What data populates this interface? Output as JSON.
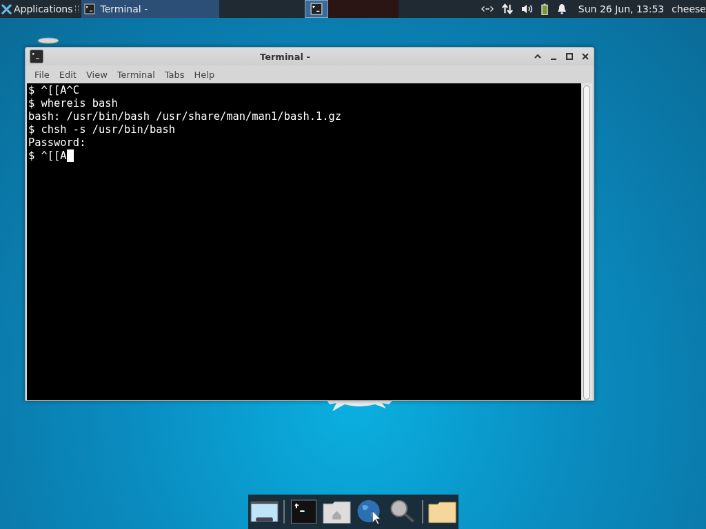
{
  "panel": {
    "app_menu": "Applications",
    "tasks": [
      {
        "title": "Terminal -",
        "selected": true
      }
    ],
    "workspaces": [
      {
        "selected": true
      },
      {
        "selected": false
      },
      {
        "selected": false
      },
      {
        "selected": false
      }
    ],
    "clock": "Sun 26 Jun, 13:53",
    "user": "cheese"
  },
  "window": {
    "title": "Terminal -",
    "menu": [
      "File",
      "Edit",
      "View",
      "Terminal",
      "Tabs",
      "Help"
    ],
    "lines": [
      "$ ^[[A^C",
      "$ whereis bash",
      "bash: /usr/bin/bash /usr/share/man/man1/bash.1.gz",
      "$ chsh -s /usr/bin/bash",
      "Password:",
      "$ ^[[A"
    ],
    "cursor": true
  },
  "dock": [
    {
      "kind": "desktop"
    },
    {
      "kind": "separator"
    },
    {
      "kind": "terminal"
    },
    {
      "kind": "home"
    },
    {
      "kind": "browser"
    },
    {
      "kind": "search"
    },
    {
      "kind": "separator"
    },
    {
      "kind": "folder"
    }
  ]
}
